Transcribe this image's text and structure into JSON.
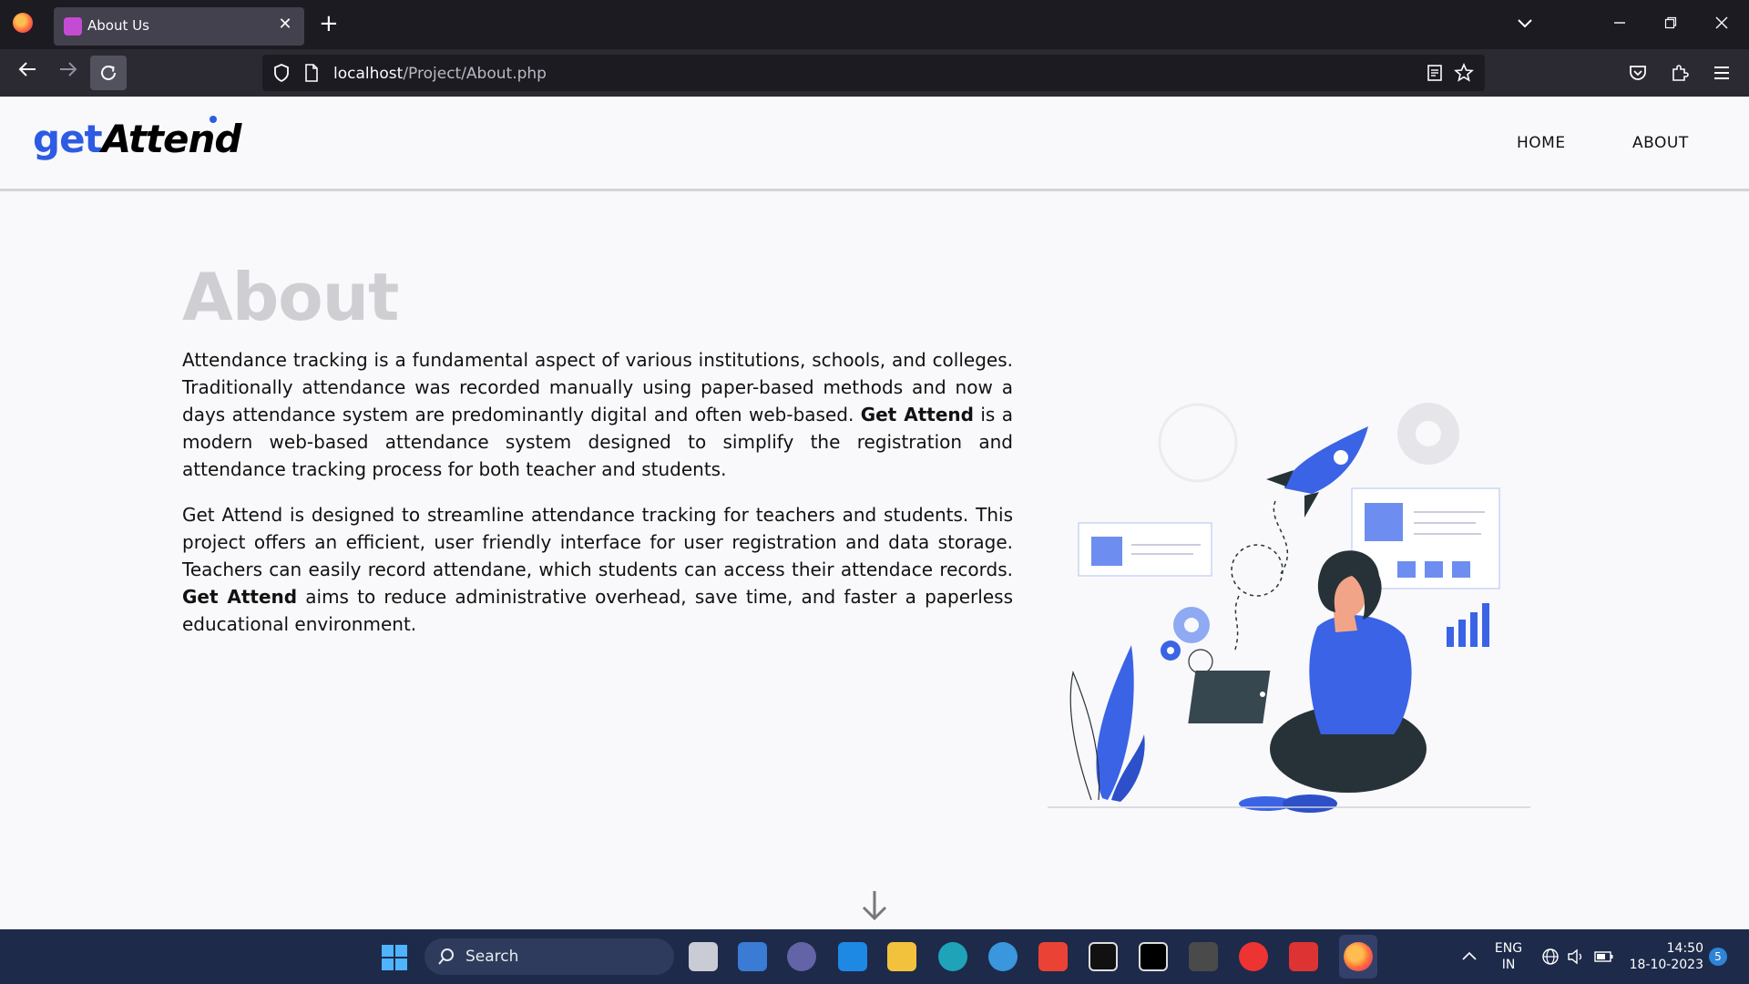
{
  "browser": {
    "tab_title": "About Us",
    "url_host": "localhost",
    "url_path": "/Project/About.php",
    "new_tab": "+",
    "tab_close": "✕"
  },
  "site": {
    "logo_part1": "get",
    "logo_part2": "Attend",
    "nav": [
      "HOME",
      "ABOUT"
    ]
  },
  "about": {
    "title": "About",
    "p1_a": "Attendance tracking is a fundamental aspect of various institutions, schools, and colleges. Traditionally attendance was recorded manually using paper-based methods and now a days attendance system are predominantly digital and often web-based. ",
    "p1_bold": "Get Attend",
    "p1_b": " is a modern web-based attendance system designed to simplify the registration and attendance tracking process for both teacher and students.",
    "p2_a": "Get Attend is designed to streamline attendance tracking for teachers and students. This project offers an efficient, user friendly interface for user registration and data storage. Teachers can easily record attendane, which students can access their attendace records. ",
    "p2_bold": "Get Attend",
    "p2_b": " aims to reduce administrative overhead, save time, and faster a paperless educational environment."
  },
  "taskbar": {
    "search_label": "Search",
    "lang_line1": "ENG",
    "lang_line2": "IN",
    "time": "14:50",
    "date": "18-10-2023",
    "notification_count": "5"
  },
  "colors": {
    "accent": "#2d5be3",
    "title_grey": "#cfcfd3",
    "chrome_dark": "#1c1b22"
  }
}
